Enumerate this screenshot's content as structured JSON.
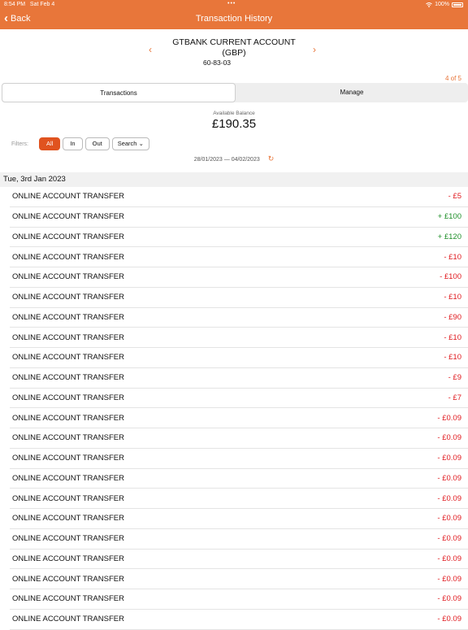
{
  "status": {
    "time": "8:54 PM",
    "date": "Sat Feb 4",
    "battery": "100%"
  },
  "nav": {
    "back_label": "Back",
    "title": "Transaction History"
  },
  "account": {
    "name": "GTBANK CURRENT ACCOUNT\n(GBP)",
    "sort_code": "60-83-03",
    "pager": "4 of 5"
  },
  "tabs": [
    "Transactions",
    "Manage"
  ],
  "balance": {
    "label": "Available Balance",
    "value": "£190.35"
  },
  "filters": {
    "label": "Filters:",
    "all": "All",
    "in": "In",
    "out": "Out",
    "search": "Search"
  },
  "date_range": "28/01/2023 — 04/02/2023",
  "day_header": "Tue, 3rd Jan 2023",
  "transactions": [
    {
      "desc": "ONLINE ACCOUNT TRANSFER",
      "amount": "- £5",
      "type": "out"
    },
    {
      "desc": "ONLINE ACCOUNT TRANSFER",
      "amount": "+ £100",
      "type": "in"
    },
    {
      "desc": "ONLINE ACCOUNT TRANSFER",
      "amount": "+ £120",
      "type": "in"
    },
    {
      "desc": "ONLINE ACCOUNT TRANSFER",
      "amount": "- £10",
      "type": "out"
    },
    {
      "desc": "ONLINE ACCOUNT TRANSFER",
      "amount": "- £100",
      "type": "out"
    },
    {
      "desc": "ONLINE ACCOUNT TRANSFER",
      "amount": "- £10",
      "type": "out"
    },
    {
      "desc": "ONLINE ACCOUNT TRANSFER",
      "amount": "- £90",
      "type": "out"
    },
    {
      "desc": "ONLINE ACCOUNT TRANSFER",
      "amount": "- £10",
      "type": "out"
    },
    {
      "desc": "ONLINE ACCOUNT TRANSFER",
      "amount": "- £10",
      "type": "out"
    },
    {
      "desc": "ONLINE ACCOUNT TRANSFER",
      "amount": "- £9",
      "type": "out"
    },
    {
      "desc": "ONLINE ACCOUNT TRANSFER",
      "amount": "- £7",
      "type": "out"
    },
    {
      "desc": "ONLINE ACCOUNT TRANSFER",
      "amount": "- £0.09",
      "type": "out"
    },
    {
      "desc": "ONLINE ACCOUNT TRANSFER",
      "amount": "- £0.09",
      "type": "out"
    },
    {
      "desc": "ONLINE ACCOUNT TRANSFER",
      "amount": "- £0.09",
      "type": "out"
    },
    {
      "desc": "ONLINE ACCOUNT TRANSFER",
      "amount": "- £0.09",
      "type": "out"
    },
    {
      "desc": "ONLINE ACCOUNT TRANSFER",
      "amount": "- £0.09",
      "type": "out"
    },
    {
      "desc": "ONLINE ACCOUNT TRANSFER",
      "amount": "- £0.09",
      "type": "out"
    },
    {
      "desc": "ONLINE ACCOUNT TRANSFER",
      "amount": "- £0.09",
      "type": "out"
    },
    {
      "desc": "ONLINE ACCOUNT TRANSFER",
      "amount": "- £0.09",
      "type": "out"
    },
    {
      "desc": "ONLINE ACCOUNT TRANSFER",
      "amount": "- £0.09",
      "type": "out"
    },
    {
      "desc": "ONLINE ACCOUNT TRANSFER",
      "amount": "- £0.09",
      "type": "out"
    },
    {
      "desc": "ONLINE ACCOUNT TRANSFER",
      "amount": "- £0.09",
      "type": "out"
    }
  ],
  "colors": {
    "accent": "#e8763a",
    "negative": "#e0191e",
    "positive": "#1f8f2a"
  },
  "icons": {
    "back": "chevron-left-icon",
    "prev": "chevron-left-icon",
    "next": "chevron-right-icon",
    "refresh": "refresh-icon",
    "search_dropdown": "chevron-down-icon"
  }
}
